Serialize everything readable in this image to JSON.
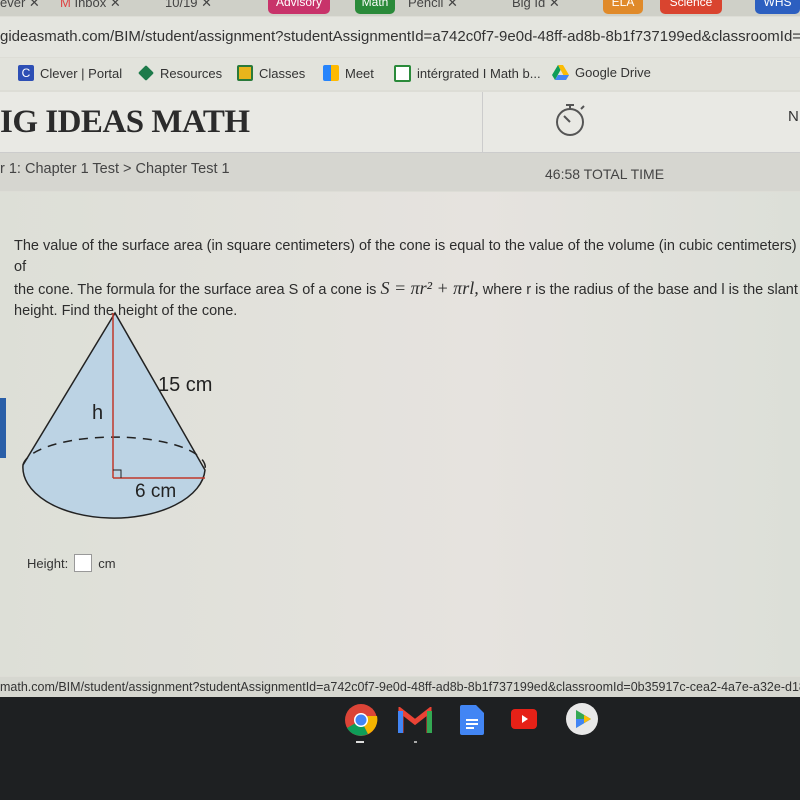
{
  "browser": {
    "tabs": [
      {
        "label": "ever"
      },
      {
        "label": "Inbox"
      },
      {
        "label": "10/19"
      },
      {
        "label": "Advisory",
        "color": "#c8336a"
      },
      {
        "label": "Math",
        "color": "#2a8a3a"
      },
      {
        "label": "Pencil"
      },
      {
        "label": "Big Id"
      },
      {
        "label": "ELA",
        "color": "#e08a2a"
      },
      {
        "label": "Science",
        "color": "#d9442f"
      },
      {
        "label": "WHS",
        "color": "#2c5fc0"
      }
    ],
    "url": "gideasmath.com/BIM/student/assignment?studentAssignmentId=a742c0f7-9e0d-48ff-ad8b-8b1f737199ed&classroomId=0b",
    "bookmarks": [
      {
        "label": "Clever | Portal",
        "icon": "clever-icon"
      },
      {
        "label": "Resources",
        "icon": "resources-icon"
      },
      {
        "label": "Classes",
        "icon": "classroom-icon"
      },
      {
        "label": "Meet",
        "icon": "meet-icon"
      },
      {
        "label": "intérgrated I Math b...",
        "icon": "sheet-icon"
      },
      {
        "label": "Google Drive",
        "icon": "drive-icon"
      }
    ],
    "status_url": "math.com/BIM/student/assignment?studentAssignmentId=a742c0f7-9e0d-48ff-ad8b-8b1f737199ed&classroomId=0b35917c-cea2-4a7e-a32e-d18f5fc16"
  },
  "header": {
    "logo": "IG IDEAS MATH",
    "right_text": "N",
    "timer_icon": "stopwatch-icon"
  },
  "breadcrumb": {
    "text": "r 1: Chapter 1 Test > Chapter Test 1",
    "total_time": "46:58 TOTAL TIME"
  },
  "question": {
    "line1": "The value of the surface area (in square centimeters) of the cone is equal to the value of the volume (in cubic centimeters) of",
    "line2a": "the cone.  The formula for the surface area S of a cone is ",
    "formula": "S = πr² + πrl,",
    "line2b": " where r is the radius of the base and l is the slant",
    "line3": "height. Find the height of the cone."
  },
  "figure": {
    "slant_label": "15 cm",
    "height_label": "h",
    "radius_label": "6 cm"
  },
  "answer": {
    "label": "Height:",
    "value": "",
    "unit": "cm"
  },
  "shelf": {
    "apps": [
      "chrome-icon",
      "gmail-icon",
      "docs-icon",
      "youtube-icon",
      "play-store-icon"
    ]
  }
}
